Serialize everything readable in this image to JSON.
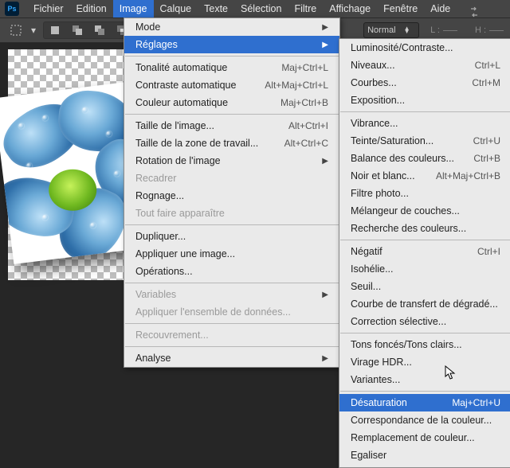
{
  "app": {
    "logo_text": "Ps"
  },
  "menubar": {
    "items": [
      "Fichier",
      "Edition",
      "Image",
      "Calque",
      "Texte",
      "Sélection",
      "Filtre",
      "Affichage",
      "Fenêtre",
      "Aide"
    ],
    "open_index": 2
  },
  "toolbar": {
    "mode_label": "Normal",
    "l_label": "L :",
    "h_label": "H :"
  },
  "menu1": [
    {
      "type": "item",
      "label": "Mode",
      "arrow": true
    },
    {
      "type": "item",
      "label": "Réglages",
      "arrow": true,
      "hl": true
    },
    {
      "type": "sep"
    },
    {
      "type": "item",
      "label": "Tonalité automatique",
      "short": "Maj+Ctrl+L"
    },
    {
      "type": "item",
      "label": "Contraste automatique",
      "short": "Alt+Maj+Ctrl+L"
    },
    {
      "type": "item",
      "label": "Couleur automatique",
      "short": "Maj+Ctrl+B"
    },
    {
      "type": "sep"
    },
    {
      "type": "item",
      "label": "Taille de l'image...",
      "short": "Alt+Ctrl+I"
    },
    {
      "type": "item",
      "label": "Taille de la zone de travail...",
      "short": "Alt+Ctrl+C"
    },
    {
      "type": "item",
      "label": "Rotation de l'image",
      "arrow": true
    },
    {
      "type": "item",
      "label": "Recadrer",
      "dis": true
    },
    {
      "type": "item",
      "label": "Rognage..."
    },
    {
      "type": "item",
      "label": "Tout faire apparaître",
      "dis": true
    },
    {
      "type": "sep"
    },
    {
      "type": "item",
      "label": "Dupliquer..."
    },
    {
      "type": "item",
      "label": "Appliquer une image..."
    },
    {
      "type": "item",
      "label": "Opérations..."
    },
    {
      "type": "sep"
    },
    {
      "type": "item",
      "label": "Variables",
      "arrow": true,
      "dis": true
    },
    {
      "type": "item",
      "label": "Appliquer l'ensemble de données...",
      "dis": true
    },
    {
      "type": "sep"
    },
    {
      "type": "item",
      "label": "Recouvrement...",
      "dis": true
    },
    {
      "type": "sep"
    },
    {
      "type": "item",
      "label": "Analyse",
      "arrow": true
    }
  ],
  "menu2": [
    {
      "type": "item",
      "label": "Luminosité/Contraste..."
    },
    {
      "type": "item",
      "label": "Niveaux...",
      "short": "Ctrl+L"
    },
    {
      "type": "item",
      "label": "Courbes...",
      "short": "Ctrl+M"
    },
    {
      "type": "item",
      "label": "Exposition..."
    },
    {
      "type": "sep"
    },
    {
      "type": "item",
      "label": "Vibrance..."
    },
    {
      "type": "item",
      "label": "Teinte/Saturation...",
      "short": "Ctrl+U"
    },
    {
      "type": "item",
      "label": "Balance des couleurs...",
      "short": "Ctrl+B"
    },
    {
      "type": "item",
      "label": "Noir et blanc...",
      "short": "Alt+Maj+Ctrl+B"
    },
    {
      "type": "item",
      "label": "Filtre photo..."
    },
    {
      "type": "item",
      "label": "Mélangeur de couches..."
    },
    {
      "type": "item",
      "label": "Recherche des couleurs..."
    },
    {
      "type": "sep"
    },
    {
      "type": "item",
      "label": "Négatif",
      "short": "Ctrl+I"
    },
    {
      "type": "item",
      "label": "Isohélie..."
    },
    {
      "type": "item",
      "label": "Seuil..."
    },
    {
      "type": "item",
      "label": "Courbe de transfert de dégradé..."
    },
    {
      "type": "item",
      "label": "Correction sélective..."
    },
    {
      "type": "sep"
    },
    {
      "type": "item",
      "label": "Tons foncés/Tons clairs..."
    },
    {
      "type": "item",
      "label": "Virage HDR..."
    },
    {
      "type": "item",
      "label": "Variantes..."
    },
    {
      "type": "sep"
    },
    {
      "type": "item",
      "label": "Désaturation",
      "short": "Maj+Ctrl+U",
      "hl": true
    },
    {
      "type": "item",
      "label": "Correspondance de la couleur..."
    },
    {
      "type": "item",
      "label": "Remplacement de couleur..."
    },
    {
      "type": "item",
      "label": "Egaliser"
    }
  ]
}
